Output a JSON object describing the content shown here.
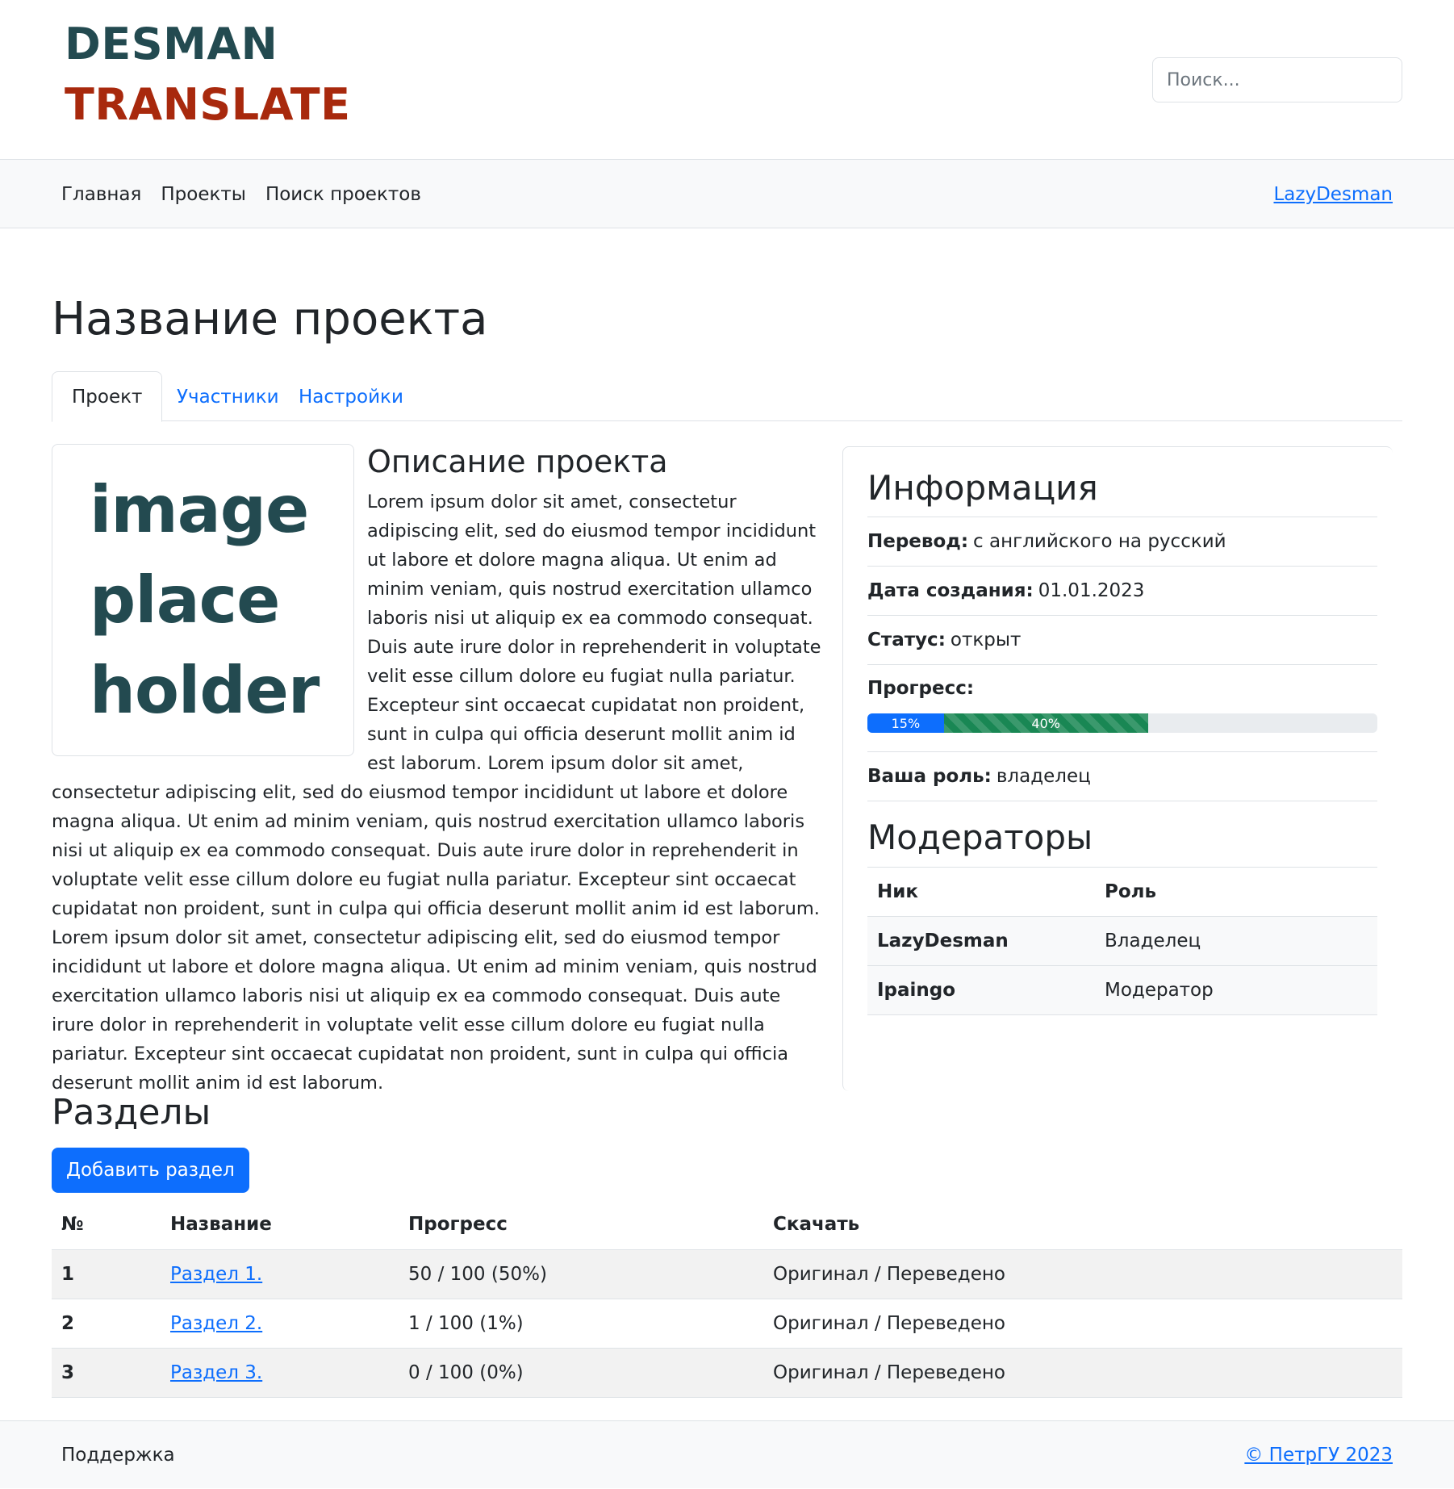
{
  "header": {
    "logo_line1": "DESMAN",
    "logo_line2": "TRANSLATE",
    "search_placeholder": "Поиск..."
  },
  "nav": {
    "items": [
      "Главная",
      "Проекты",
      "Поиск проектов"
    ],
    "user": "LazyDesman"
  },
  "page": {
    "title": "Название проекта",
    "tabs": [
      "Проект",
      "Участники",
      "Настройки"
    ],
    "active_tab": "Проект"
  },
  "description": {
    "image_text": [
      "image",
      "place",
      "holder"
    ],
    "title": "Описание проекта",
    "text": "Lorem ipsum dolor sit amet, consectetur adipiscing elit, sed do eiusmod tempor incididunt ut labore et dolore magna aliqua. Ut enim ad minim veniam, quis nostrud exercitation ullamco laboris nisi ut aliquip ex ea commodo consequat. Duis aute irure dolor in reprehenderit in voluptate velit esse cillum dolore eu fugiat nulla pariatur. Excepteur sint occaecat cupidatat non proident, sunt in culpa qui officia deserunt mollit anim id est laborum. Lorem ipsum dolor sit amet, consectetur adipiscing elit, sed do eiusmod tempor incididunt ut labore et dolore magna aliqua. Ut enim ad minim veniam, quis nostrud exercitation ullamco laboris nisi ut aliquip ex ea commodo consequat. Duis aute irure dolor in reprehenderit in voluptate velit esse cillum dolore eu fugiat nulla pariatur. Excepteur sint occaecat cupidatat non proident, sunt in culpa qui officia deserunt mollit anim id est laborum. Lorem ipsum dolor sit amet, consectetur adipiscing elit, sed do eiusmod tempor incididunt ut labore et dolore magna aliqua. Ut enim ad minim veniam, quis nostrud exercitation ullamco laboris nisi ut aliquip ex ea commodo consequat. Duis aute irure dolor in reprehenderit in voluptate velit esse cillum dolore eu fugiat nulla pariatur. Excepteur sint occaecat cupidatat non proident, sunt in culpa qui officia deserunt mollit anim id est laborum."
  },
  "info": {
    "title": "Информация",
    "translation_label": "Перевод:",
    "translation_value": "с английского на русский",
    "created_label": "Дата создания:",
    "created_value": "01.01.2023",
    "status_label": "Статус:",
    "status_value": "открыт",
    "progress_label": "Прогресс:",
    "progress_bars": [
      {
        "label": "15%",
        "fraction": 0.15,
        "color": "#0d6efd"
      },
      {
        "label": "40%",
        "fraction": 0.4,
        "color": "#198754"
      }
    ],
    "role_label": "Ваша роль:",
    "role_value": "владелец"
  },
  "moderators": {
    "title": "Модераторы",
    "columns": [
      "Ник",
      "Роль"
    ],
    "rows": [
      {
        "nick": "LazyDesman",
        "role": "Владелец"
      },
      {
        "nick": "Ipaingo",
        "role": "Модератор"
      }
    ]
  },
  "sections": {
    "title": "Разделы",
    "add_button": "Добавить раздел",
    "columns": [
      "№",
      "Название",
      "Прогресс",
      "Скачать"
    ],
    "rows": [
      {
        "num": "1",
        "name": "Раздел 1.",
        "progress": "50 / 100 (50%)",
        "download": "Оригинал / Переведено"
      },
      {
        "num": "2",
        "name": "Раздел 2.",
        "progress": "1 / 100 (1%)",
        "download": "Оригинал / Переведено"
      },
      {
        "num": "3",
        "name": "Раздел 3.",
        "progress": "0 / 100 (0%)",
        "download": "Оригинал / Переведено"
      }
    ]
  },
  "footer": {
    "support": "Поддержка",
    "copyright": "© ПетрГУ 2023"
  }
}
